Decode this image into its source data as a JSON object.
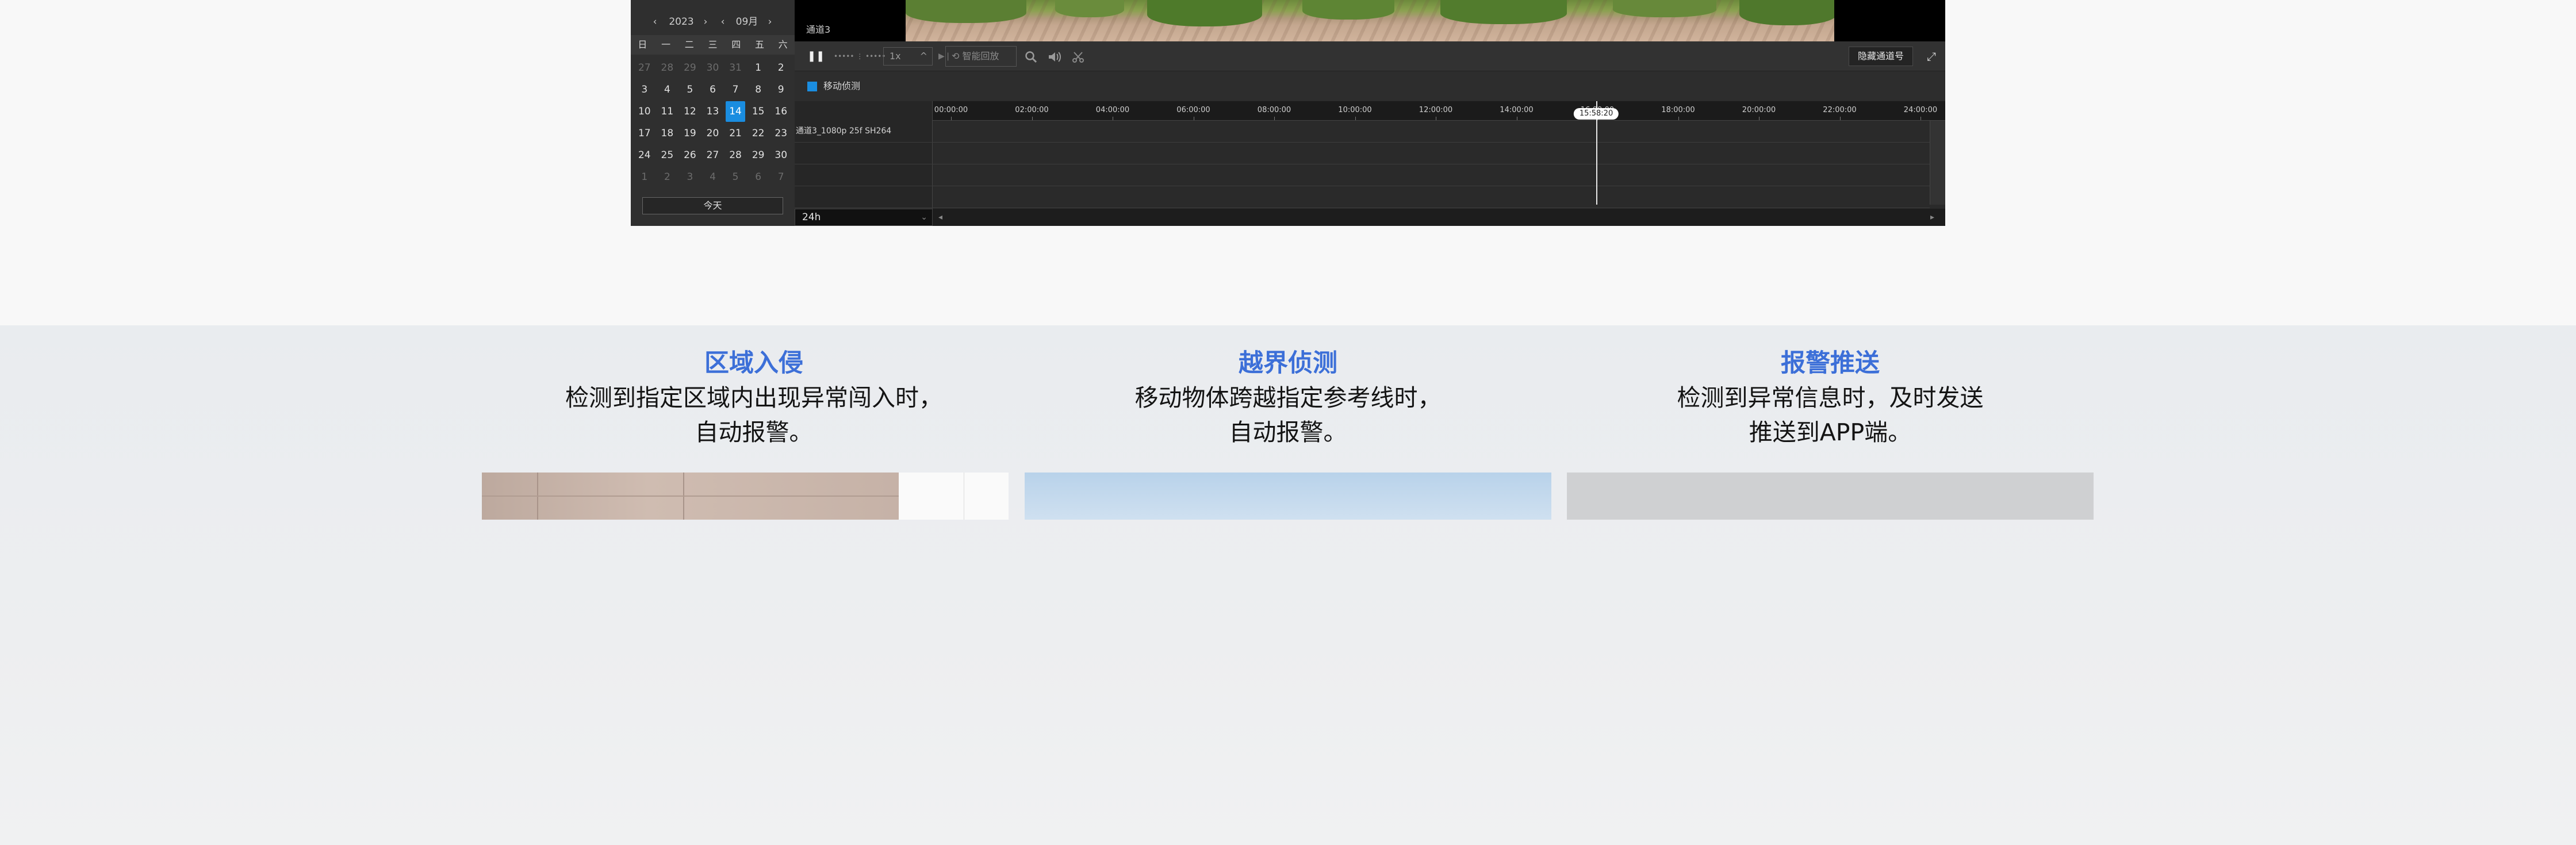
{
  "calendar": {
    "year": "2023",
    "month": "09月",
    "prev_icon": "‹",
    "next_icon": "›",
    "weekdays": [
      "日",
      "一",
      "二",
      "三",
      "四",
      "五",
      "六"
    ],
    "days": [
      {
        "d": "27",
        "dim": true
      },
      {
        "d": "28",
        "dim": true
      },
      {
        "d": "29",
        "dim": true
      },
      {
        "d": "30",
        "dim": true
      },
      {
        "d": "31",
        "dim": true
      },
      {
        "d": "1"
      },
      {
        "d": "2"
      },
      {
        "d": "3"
      },
      {
        "d": "4"
      },
      {
        "d": "5"
      },
      {
        "d": "6"
      },
      {
        "d": "7"
      },
      {
        "d": "8"
      },
      {
        "d": "9"
      },
      {
        "d": "10"
      },
      {
        "d": "11"
      },
      {
        "d": "12"
      },
      {
        "d": "13"
      },
      {
        "d": "14",
        "sel": true
      },
      {
        "d": "15"
      },
      {
        "d": "16"
      },
      {
        "d": "17"
      },
      {
        "d": "18"
      },
      {
        "d": "19"
      },
      {
        "d": "20"
      },
      {
        "d": "21"
      },
      {
        "d": "22"
      },
      {
        "d": "23"
      },
      {
        "d": "24"
      },
      {
        "d": "25"
      },
      {
        "d": "26"
      },
      {
        "d": "27"
      },
      {
        "d": "28"
      },
      {
        "d": "29"
      },
      {
        "d": "30"
      },
      {
        "d": "1",
        "dim": true
      },
      {
        "d": "2",
        "dim": true
      },
      {
        "d": "3",
        "dim": true
      },
      {
        "d": "4",
        "dim": true
      },
      {
        "d": "5",
        "dim": true
      },
      {
        "d": "6",
        "dim": true
      },
      {
        "d": "7",
        "dim": true
      }
    ],
    "today_label": "今天"
  },
  "video": {
    "channel_label": "通道3"
  },
  "toolbar": {
    "pause_icon": "❚❚",
    "volume_slider": "••••• ⋮ •••••",
    "speed": "1x",
    "speed_caret": "^",
    "frame_icon": "▶❘",
    "smart_playback": "智能回放",
    "smart_icon": "⟲",
    "zoom_icon": "search-icon",
    "volume_icon": "volume-icon",
    "clip_icon": "scissors-icon",
    "hide_channel": "隐藏通道号",
    "fullscreen_icon": "⤢"
  },
  "detection": {
    "label": "移动侦测",
    "color": "#1a8de0"
  },
  "timeline": {
    "channel_row": "通道3_1080p 25f SH264",
    "ticks": [
      "00:00:00",
      "02:00:00",
      "04:00:00",
      "06:00:00",
      "08:00:00",
      "10:00:00",
      "12:00:00",
      "14:00:00",
      "16:00:00",
      "18:00:00",
      "20:00:00",
      "22:00:00",
      "24:00:00"
    ],
    "current_time": "15:58:20",
    "current_hours": 15.972,
    "zoom": "24h",
    "zoom_caret": "⌄",
    "scroll_left": "◂",
    "scroll_right": "▸"
  },
  "features": [
    {
      "title": "区域入侵",
      "line1": "检测到指定区域内出现异常闯入时，",
      "line2": "自动报警。"
    },
    {
      "title": "越界侦测",
      "line1": "移动物体跨越指定参考线时，",
      "line2": "自动报警。"
    },
    {
      "title": "报警推送",
      "line1": "检测到异常信息时，及时发送",
      "line2": "推送到APP端。"
    }
  ],
  "colors": {
    "accent": "#1a8de0",
    "feature_title": "#3c6fd8"
  }
}
